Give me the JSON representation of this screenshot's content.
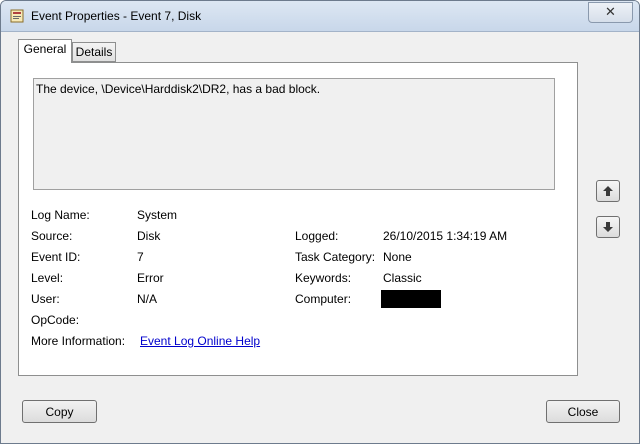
{
  "window": {
    "title": "Event Properties - Event 7, Disk",
    "close_glyph": "✕"
  },
  "tabs": [
    {
      "label": "General",
      "active": true
    },
    {
      "label": "Details",
      "active": false
    }
  ],
  "general": {
    "description": "The device, \\Device\\Harddisk2\\DR2, has a bad block.",
    "fields_left": [
      {
        "label": "Log Name:",
        "value": "System"
      },
      {
        "label": "Source:",
        "value": "Disk"
      },
      {
        "label": "Event ID:",
        "value": "7"
      },
      {
        "label": "Level:",
        "value": "Error"
      },
      {
        "label": "User:",
        "value": "N/A"
      },
      {
        "label": "OpCode:",
        "value": ""
      },
      {
        "label": "More Information:",
        "value": "Event Log Online Help"
      }
    ],
    "fields_right": [
      {
        "label": "Logged:",
        "value": "26/10/2015 1:34:19 AM"
      },
      {
        "label": "Task Category:",
        "value": "None"
      },
      {
        "label": "Keywords:",
        "value": "Classic"
      },
      {
        "label": "Computer:",
        "value": ""
      }
    ]
  },
  "buttons": {
    "copy": "Copy",
    "close": "Close"
  },
  "icons": {
    "app": "event-properties-icon",
    "up": "arrow-up-icon",
    "down": "arrow-down-icon"
  }
}
